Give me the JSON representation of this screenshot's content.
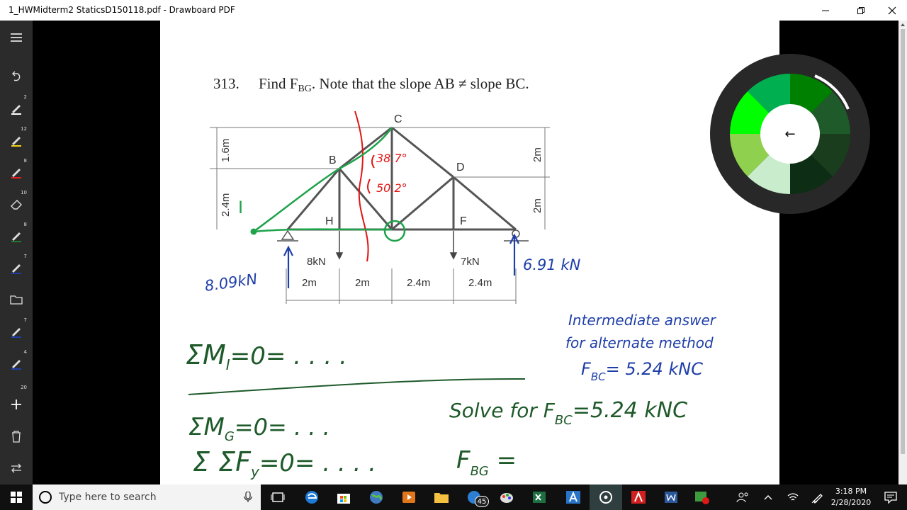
{
  "window": {
    "title": "1_HWMidterm2 StaticsD150118.pdf - Drawboard PDF",
    "minimize_icon": "minimize-icon",
    "maximize_icon": "restore-icon",
    "close_icon": "close-icon"
  },
  "sidebar": {
    "tools": [
      {
        "name": "menu-icon",
        "badge": ""
      },
      {
        "name": "undo-icon",
        "badge": ""
      },
      {
        "name": "pen-icon",
        "badge": "2",
        "color": "#ffffff"
      },
      {
        "name": "highlighter-icon",
        "badge": "12",
        "color": "#f2d21b"
      },
      {
        "name": "pen-icon",
        "badge": "8",
        "color": "#e02020"
      },
      {
        "name": "eraser-icon",
        "badge": "10",
        "color": "#ffffff"
      },
      {
        "name": "pen-icon",
        "badge": "8",
        "color": "#1e7a35"
      },
      {
        "name": "pen-icon",
        "badge": "7",
        "color": "#1f3fa8"
      },
      {
        "name": "folder-icon",
        "badge": ""
      },
      {
        "name": "pen-icon",
        "badge": "7",
        "color": "#1f3fa8"
      },
      {
        "name": "pen-icon",
        "badge": "4",
        "color": "#1f3fa8"
      },
      {
        "name": "plus-icon",
        "badge": "20"
      },
      {
        "name": "trash-icon",
        "badge": ""
      },
      {
        "name": "swap-icon",
        "badge": ""
      }
    ]
  },
  "document": {
    "problem_number": "313.",
    "problem_text_1": "Find F",
    "problem_sub": "BG",
    "problem_text_2": ". Note that the slope AB ≠ slope BC.",
    "node_labels": {
      "B": "B",
      "C": "C",
      "D": "D",
      "H": "H",
      "F": "F"
    },
    "dims": {
      "left_top": "1.6m",
      "left_bottom": "2.4m",
      "right_top": "2m",
      "right_bottom": "2m",
      "bottom": [
        "2m",
        "2m",
        "2.4m",
        "2.4m"
      ]
    },
    "loads": {
      "h": "8kN",
      "f": "7kN"
    },
    "annotations": {
      "angle1": "38.7°",
      "angle2": "50.2°",
      "point_I": "I",
      "reaction_left": "8.09kN",
      "reaction_right": "6.91 kN",
      "eq1": "ΣM",
      "eq1_sub": "I",
      "eq1_rest": "=0=   . . . .",
      "eq2": "ΣM",
      "eq2_sub": "G",
      "eq2_rest": "=0=  . . .",
      "eq3": "Σ ΣF",
      "eq3_sub": "y",
      "eq3_rest": "=0=   . . . .",
      "fbg": "F",
      "fbg_sub": "BG",
      "fbg_rest": " =",
      "solve_for": "Solve for F",
      "solve_sub": "BC",
      "solve_rest": "=5.24 kNC",
      "inter_1": "Intermediate answer",
      "inter_2": "for alternate method",
      "inter_3": "F",
      "inter_3_sub": "BC",
      "inter_3_rest": "= 5.24 kNC"
    }
  },
  "color_wheel": {
    "center_icon": "back-arrow-icon",
    "center_glyph": "←",
    "swatches": [
      "#008000",
      "#1f5a2a",
      "#1a3d1e",
      "#0d2e14",
      "#c8eccc",
      "#8fd14f",
      "#00ff00",
      "#00b050"
    ]
  },
  "taskbar": {
    "search_placeholder": "Type here to search",
    "time": "3:18 PM",
    "date": "2/28/2020",
    "badge_count": "45"
  }
}
